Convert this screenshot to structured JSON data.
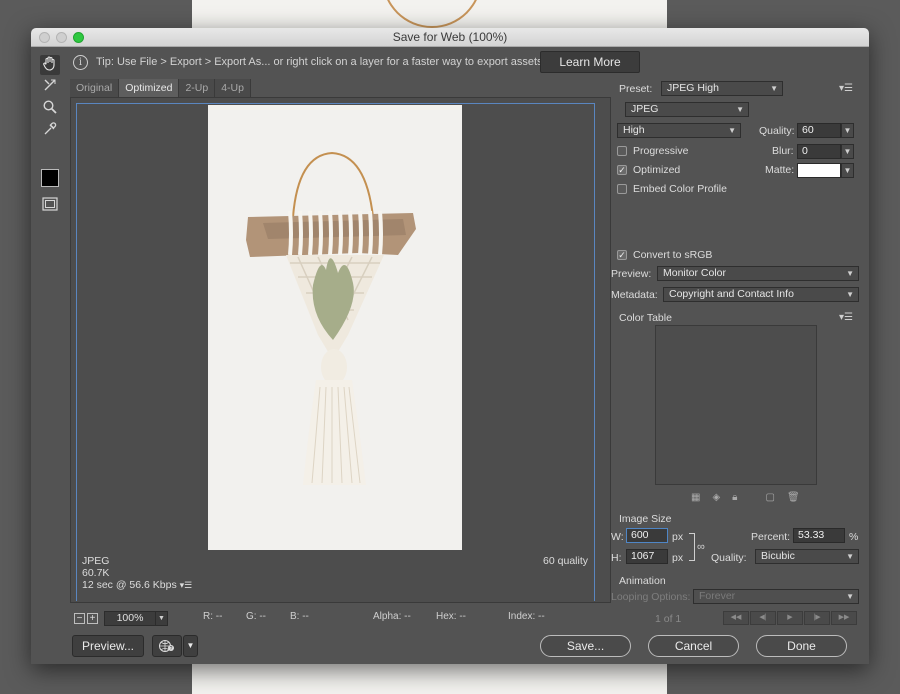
{
  "window": {
    "title": "Save for Web (100%)"
  },
  "tip": {
    "text": "Tip: Use File > Export > Export As...  or right click on a layer for a faster way to export assets",
    "button": "Learn More"
  },
  "tools": [
    "hand-tool",
    "slice-select-tool",
    "zoom-tool",
    "eyedropper-tool"
  ],
  "tabs": [
    {
      "label": "Original"
    },
    {
      "label": "Optimized",
      "active": true
    },
    {
      "label": "2-Up"
    },
    {
      "label": "4-Up"
    }
  ],
  "image_info": {
    "format": "JPEG",
    "size": "60.7K",
    "time": "12 sec @ 56.6 Kbps",
    "quality": "60 quality"
  },
  "statusbar": {
    "zoom": "100%",
    "r": "R: --",
    "g": "G: --",
    "b": "B: --",
    "alpha": "Alpha: --",
    "hex": "Hex: --",
    "index": "Index: --"
  },
  "buttons": {
    "preview": "Preview...",
    "save": "Save...",
    "cancel": "Cancel",
    "done": "Done"
  },
  "settings": {
    "preset_label": "Preset:",
    "preset_value": "JPEG High",
    "format": "JPEG",
    "quality_level": "High",
    "quality_label": "Quality:",
    "quality_value": "60",
    "blur_label": "Blur:",
    "blur_value": "0",
    "matte_label": "Matte:",
    "progressive": {
      "label": "Progressive",
      "checked": false
    },
    "optimized": {
      "label": "Optimized",
      "checked": true
    },
    "embed_profile": {
      "label": "Embed Color Profile",
      "checked": false
    },
    "convert_srgb": {
      "label": "Convert to sRGB",
      "checked": true
    },
    "preview_label": "Preview:",
    "preview_value": "Monitor Color",
    "metadata_label": "Metadata:",
    "metadata_value": "Copyright and Contact Info",
    "color_table_label": "Color Table"
  },
  "image_size": {
    "label": "Image Size",
    "w_label": "W:",
    "w_value": "600",
    "w_unit": "px",
    "h_label": "H:",
    "h_value": "1067",
    "h_unit": "px",
    "percent_label": "Percent:",
    "percent_value": "53.33",
    "percent_unit": "%",
    "quality_label": "Quality:",
    "quality_value": "Bicubic"
  },
  "animation": {
    "label": "Animation",
    "looping_label": "Looping Options:",
    "looping_value": "Forever",
    "frame": "1 of 1"
  },
  "colors": {
    "accent": "#5a86c0",
    "panel": "#535353",
    "swatch": "#000000",
    "matte": "#ffffff"
  }
}
